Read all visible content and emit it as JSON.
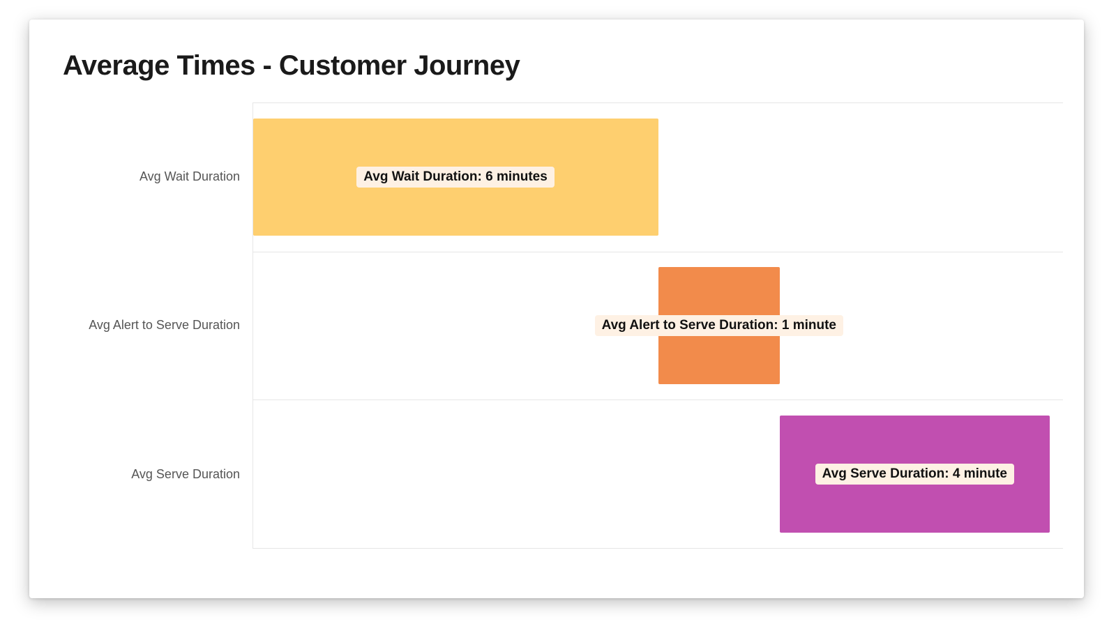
{
  "title": "Average Times - Customer Journey",
  "chart_data": {
    "type": "bar",
    "orientation": "horizontal-stacked-waterfall",
    "x_unit": "minutes",
    "xlim": [
      0,
      12
    ],
    "categories": [
      "Avg Wait Duration",
      "Avg Alert to Serve Duration",
      "Avg Serve Duration"
    ],
    "series": [
      {
        "name": "Avg Wait Duration",
        "start": 0,
        "end": 6,
        "value": 6,
        "color": "#fecf6f",
        "data_label": "Avg Wait Duration: 6 minutes"
      },
      {
        "name": "Avg Alert to Serve Duration",
        "start": 6,
        "end": 7.8,
        "value": 1,
        "color": "#f28b4b",
        "data_label": "Avg Alert to Serve Duration: 1 minute"
      },
      {
        "name": "Avg Serve Duration",
        "start": 7.8,
        "end": 11.8,
        "value": 4,
        "color": "#c14fb0",
        "data_label": "Avg Serve Duration: 4 minute"
      }
    ],
    "title": "Average Times - Customer Journey",
    "xlabel": "",
    "ylabel": ""
  }
}
